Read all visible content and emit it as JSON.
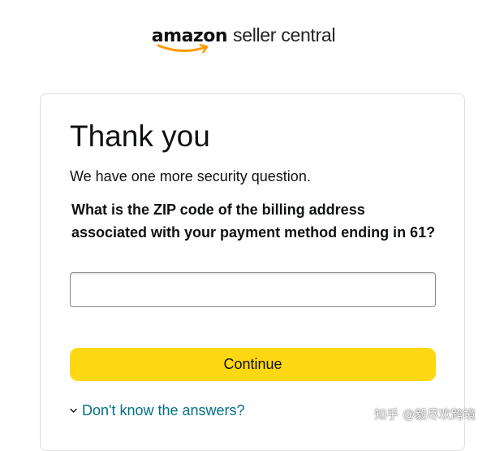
{
  "header": {
    "logo_amazon": "amazon",
    "logo_suffix": "seller central"
  },
  "card": {
    "title": "Thank you",
    "subtitle": "We have one more security question.",
    "question": "What is the ZIP code of the billing address associated with your payment method ending in 61?",
    "zip_input": {
      "value": "",
      "placeholder": ""
    },
    "continue_label": "Continue",
    "help_link_label": "Don't know the answers?"
  },
  "watermark": {
    "text": "知乎 @毅尽欢跨境"
  },
  "colors": {
    "button_bg": "#ffd814",
    "link": "#007185",
    "smile": "#ff9900",
    "text": "#0f1111"
  },
  "icons": {
    "smile": "amazon-smile-arrow-icon",
    "chevron": "chevron-down-icon"
  }
}
